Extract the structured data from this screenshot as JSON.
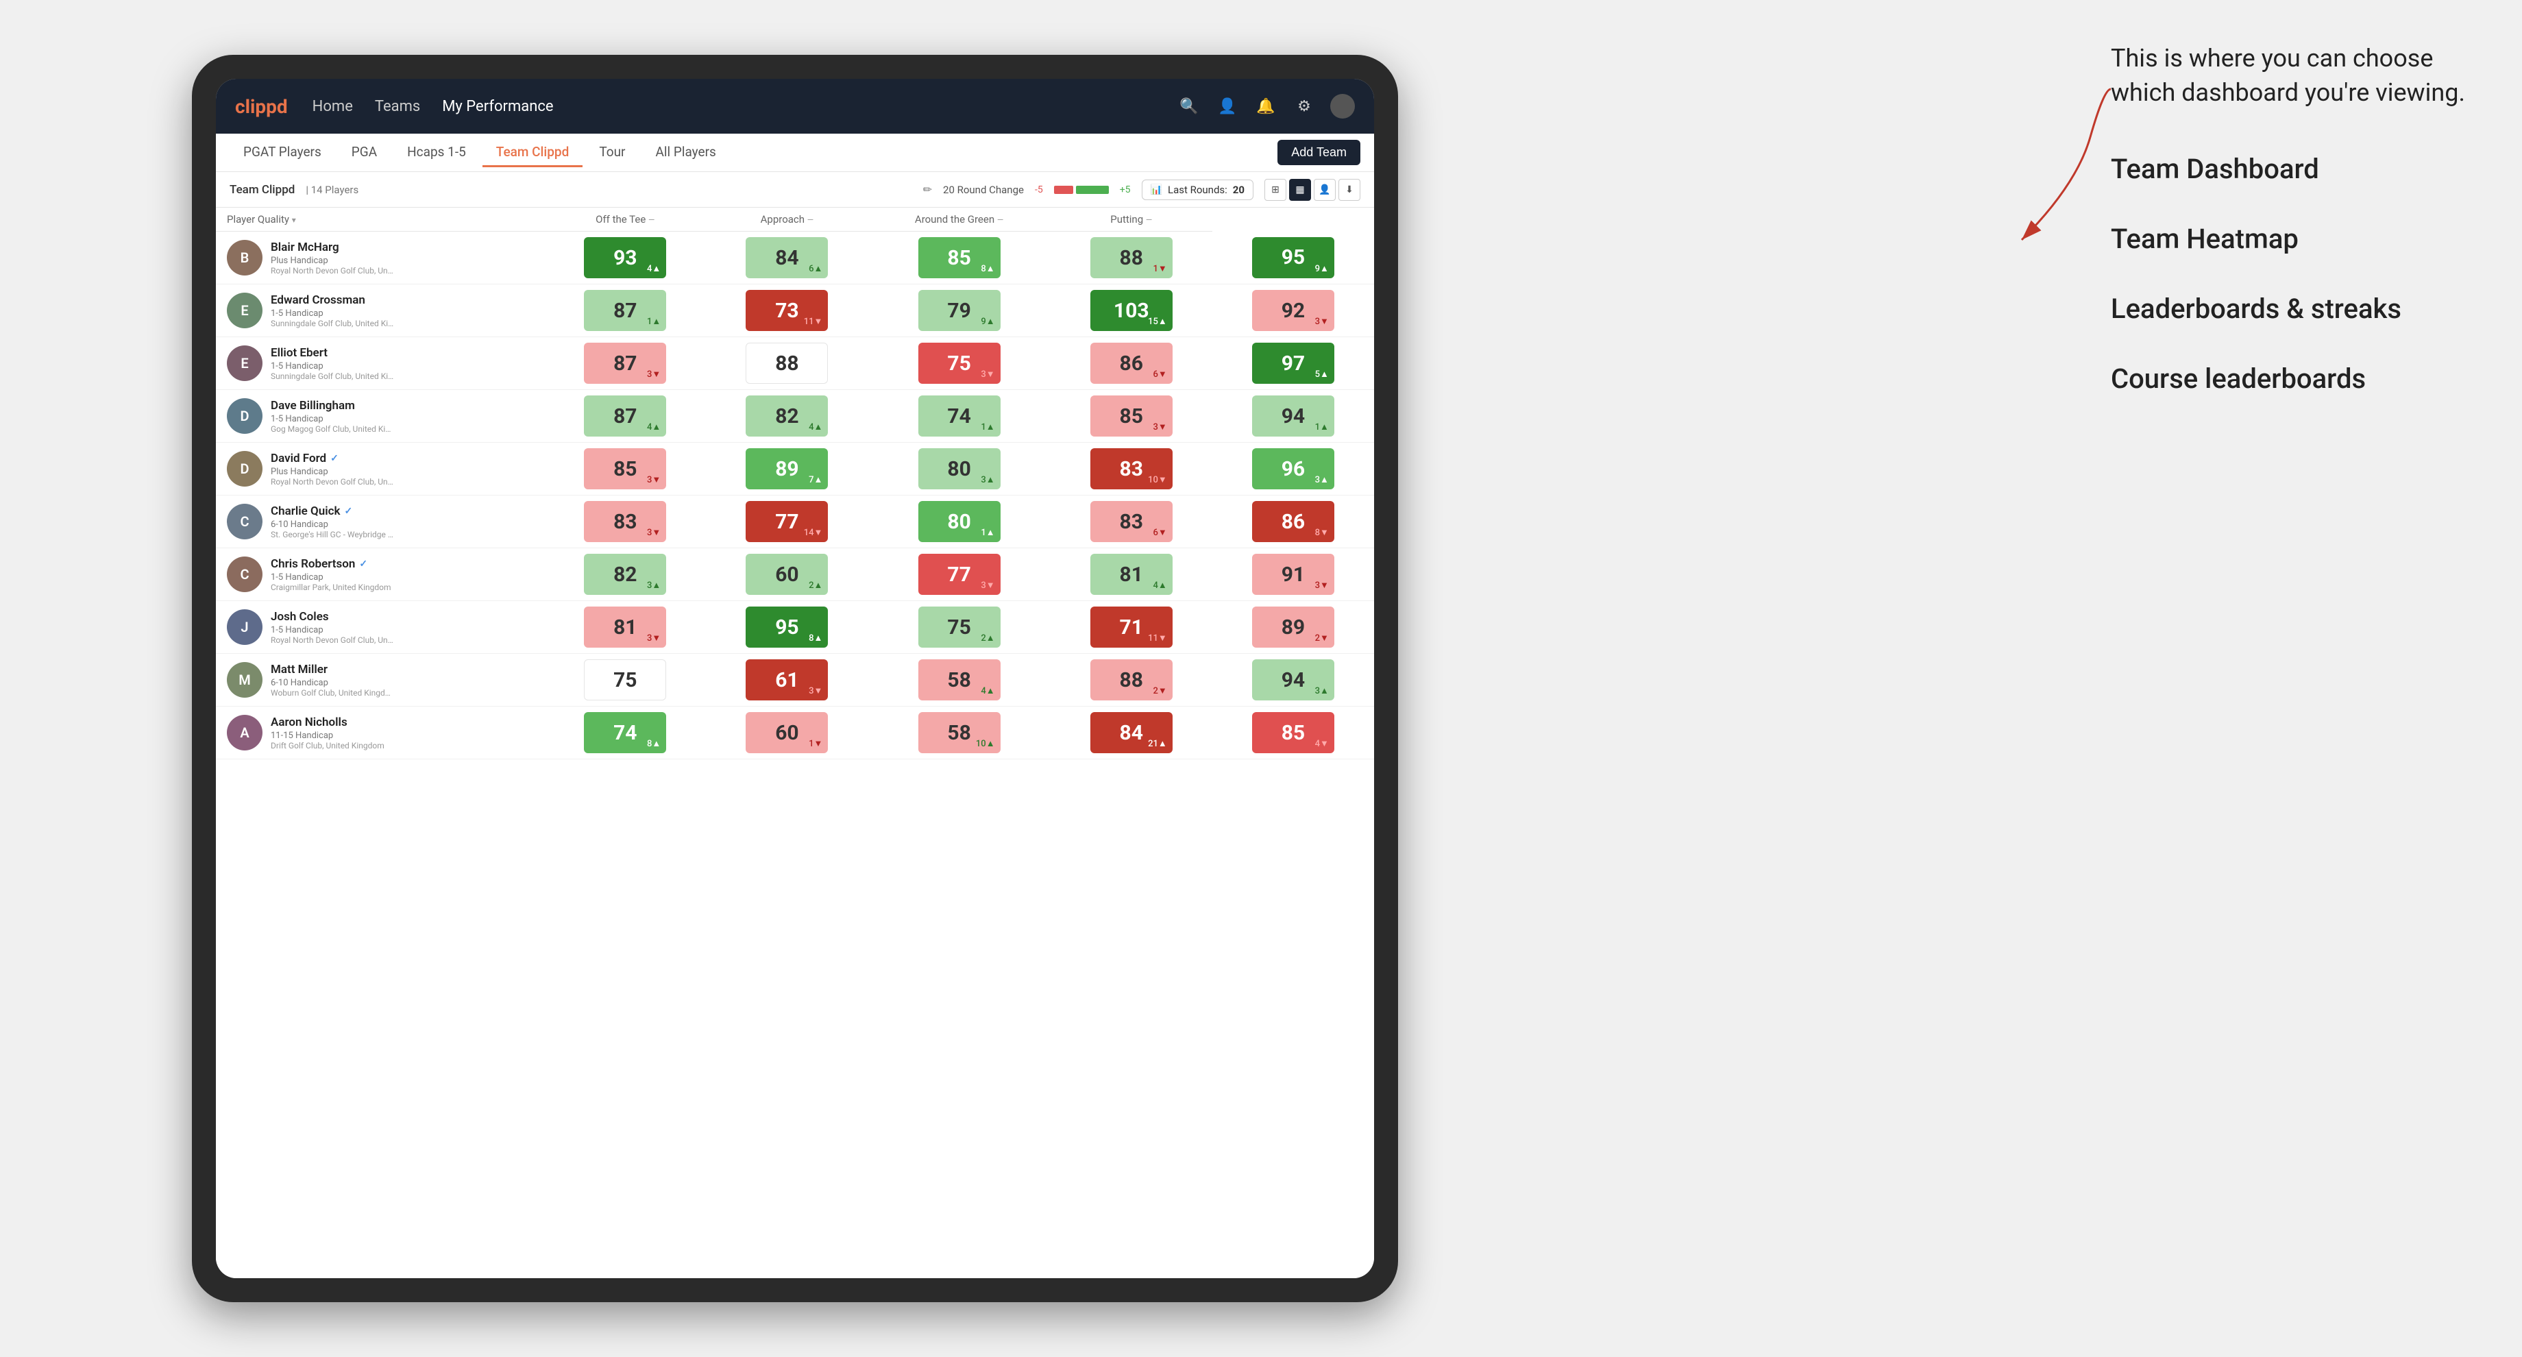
{
  "annotation": {
    "intro": "This is where you can choose which dashboard you're viewing.",
    "options": [
      "Team Dashboard",
      "Team Heatmap",
      "Leaderboards & streaks",
      "Course leaderboards"
    ]
  },
  "nav": {
    "logo": "clippd",
    "items": [
      "Home",
      "Teams",
      "My Performance"
    ],
    "active": "My Performance"
  },
  "tabs": {
    "items": [
      "PGAT Players",
      "PGA",
      "Hcaps 1-5",
      "Team Clippd",
      "Tour",
      "All Players"
    ],
    "active": "Team Clippd",
    "add_button": "Add Team"
  },
  "toolbar": {
    "team_name": "Team Clippd",
    "player_count": "| 14 Players",
    "round_change_label": "20 Round Change",
    "change_minus": "-5",
    "change_plus": "+5",
    "last_rounds_label": "Last Rounds:",
    "last_rounds_value": "20"
  },
  "table": {
    "headers": [
      {
        "label": "Player Quality",
        "sortable": true
      },
      {
        "label": "Off the Tee",
        "sortable": true
      },
      {
        "label": "Approach",
        "sortable": true
      },
      {
        "label": "Around the Green",
        "sortable": true
      },
      {
        "label": "Putting",
        "sortable": true
      }
    ],
    "players": [
      {
        "name": "Blair McHarg",
        "handicap": "Plus Handicap",
        "club": "Royal North Devon Golf Club, United Kingdom",
        "avatar_color": "#8B6F5E",
        "avatar_letter": "B",
        "scores": [
          {
            "value": 93,
            "change": 4,
            "dir": "up",
            "bg": "green-dark"
          },
          {
            "value": 84,
            "change": 6,
            "dir": "up",
            "bg": "green-light"
          },
          {
            "value": 85,
            "change": 8,
            "dir": "up",
            "bg": "green-mid"
          },
          {
            "value": 88,
            "change": 1,
            "dir": "down",
            "bg": "green-light"
          },
          {
            "value": 95,
            "change": 9,
            "dir": "up",
            "bg": "green-dark"
          }
        ]
      },
      {
        "name": "Edward Crossman",
        "handicap": "1-5 Handicap",
        "club": "Sunningdale Golf Club, United Kingdom",
        "avatar_color": "#6B8B6F",
        "avatar_letter": "E",
        "scores": [
          {
            "value": 87,
            "change": 1,
            "dir": "up",
            "bg": "green-light"
          },
          {
            "value": 73,
            "change": 11,
            "dir": "down",
            "bg": "red-dark"
          },
          {
            "value": 79,
            "change": 9,
            "dir": "up",
            "bg": "green-light"
          },
          {
            "value": 103,
            "change": 15,
            "dir": "up",
            "bg": "green-dark"
          },
          {
            "value": 92,
            "change": 3,
            "dir": "down",
            "bg": "red-light"
          }
        ]
      },
      {
        "name": "Elliot Ebert",
        "handicap": "1-5 Handicap",
        "club": "Sunningdale Golf Club, United Kingdom",
        "avatar_color": "#7B5E6B",
        "avatar_letter": "E",
        "scores": [
          {
            "value": 87,
            "change": 3,
            "dir": "down",
            "bg": "red-light"
          },
          {
            "value": 88,
            "change": null,
            "dir": null,
            "bg": "white"
          },
          {
            "value": 75,
            "change": 3,
            "dir": "down",
            "bg": "red-mid"
          },
          {
            "value": 86,
            "change": 6,
            "dir": "down",
            "bg": "red-light"
          },
          {
            "value": 97,
            "change": 5,
            "dir": "up",
            "bg": "green-dark"
          }
        ]
      },
      {
        "name": "Dave Billingham",
        "handicap": "1-5 Handicap",
        "club": "Gog Magog Golf Club, United Kingdom",
        "avatar_color": "#5E7B8B",
        "avatar_letter": "D",
        "scores": [
          {
            "value": 87,
            "change": 4,
            "dir": "up",
            "bg": "green-light"
          },
          {
            "value": 82,
            "change": 4,
            "dir": "up",
            "bg": "green-light"
          },
          {
            "value": 74,
            "change": 1,
            "dir": "up",
            "bg": "green-light"
          },
          {
            "value": 85,
            "change": 3,
            "dir": "down",
            "bg": "red-light"
          },
          {
            "value": 94,
            "change": 1,
            "dir": "up",
            "bg": "green-light"
          }
        ]
      },
      {
        "name": "David Ford",
        "handicap": "Plus Handicap",
        "club": "Royal North Devon Golf Club, United Kingdom",
        "avatar_color": "#8B7B5E",
        "avatar_letter": "D",
        "verified": true,
        "scores": [
          {
            "value": 85,
            "change": 3,
            "dir": "down",
            "bg": "red-light"
          },
          {
            "value": 89,
            "change": 7,
            "dir": "up",
            "bg": "green-mid"
          },
          {
            "value": 80,
            "change": 3,
            "dir": "up",
            "bg": "green-light"
          },
          {
            "value": 83,
            "change": 10,
            "dir": "down",
            "bg": "red-dark"
          },
          {
            "value": 96,
            "change": 3,
            "dir": "up",
            "bg": "green-mid"
          }
        ]
      },
      {
        "name": "Charlie Quick",
        "handicap": "6-10 Handicap",
        "club": "St. George's Hill GC - Weybridge - Surrey, Uni...",
        "avatar_color": "#6B7B8B",
        "avatar_letter": "C",
        "verified": true,
        "scores": [
          {
            "value": 83,
            "change": 3,
            "dir": "down",
            "bg": "red-light"
          },
          {
            "value": 77,
            "change": 14,
            "dir": "down",
            "bg": "red-dark"
          },
          {
            "value": 80,
            "change": 1,
            "dir": "up",
            "bg": "green-mid"
          },
          {
            "value": 83,
            "change": 6,
            "dir": "down",
            "bg": "red-light"
          },
          {
            "value": 86,
            "change": 8,
            "dir": "down",
            "bg": "red-dark"
          }
        ]
      },
      {
        "name": "Chris Robertson",
        "handicap": "1-5 Handicap",
        "club": "Craigmillar Park, United Kingdom",
        "avatar_color": "#8B6B5E",
        "avatar_letter": "C",
        "verified": true,
        "scores": [
          {
            "value": 82,
            "change": 3,
            "dir": "up",
            "bg": "green-light"
          },
          {
            "value": 60,
            "change": 2,
            "dir": "up",
            "bg": "green-light"
          },
          {
            "value": 77,
            "change": 3,
            "dir": "down",
            "bg": "red-mid"
          },
          {
            "value": 81,
            "change": 4,
            "dir": "up",
            "bg": "green-light"
          },
          {
            "value": 91,
            "change": 3,
            "dir": "down",
            "bg": "red-light"
          }
        ]
      },
      {
        "name": "Josh Coles",
        "handicap": "1-5 Handicap",
        "club": "Royal North Devon Golf Club, United Kingdom",
        "avatar_color": "#5E6B8B",
        "avatar_letter": "J",
        "scores": [
          {
            "value": 81,
            "change": 3,
            "dir": "down",
            "bg": "red-light"
          },
          {
            "value": 95,
            "change": 8,
            "dir": "up",
            "bg": "green-dark"
          },
          {
            "value": 75,
            "change": 2,
            "dir": "up",
            "bg": "green-light"
          },
          {
            "value": 71,
            "change": 11,
            "dir": "down",
            "bg": "red-dark"
          },
          {
            "value": 89,
            "change": 2,
            "dir": "down",
            "bg": "red-light"
          }
        ]
      },
      {
        "name": "Matt Miller",
        "handicap": "6-10 Handicap",
        "club": "Woburn Golf Club, United Kingdom",
        "avatar_color": "#7B8B6B",
        "avatar_letter": "M",
        "scores": [
          {
            "value": 75,
            "change": null,
            "dir": null,
            "bg": "white"
          },
          {
            "value": 61,
            "change": 3,
            "dir": "down",
            "bg": "red-dark"
          },
          {
            "value": 58,
            "change": 4,
            "dir": "up",
            "bg": "red-light"
          },
          {
            "value": 88,
            "change": 2,
            "dir": "down",
            "bg": "red-light"
          },
          {
            "value": 94,
            "change": 3,
            "dir": "up",
            "bg": "green-light"
          }
        ]
      },
      {
        "name": "Aaron Nicholls",
        "handicap": "11-15 Handicap",
        "club": "Drift Golf Club, United Kingdom",
        "avatar_color": "#8B5E7B",
        "avatar_letter": "A",
        "scores": [
          {
            "value": 74,
            "change": 8,
            "dir": "up",
            "bg": "green-mid"
          },
          {
            "value": 60,
            "change": 1,
            "dir": "down",
            "bg": "red-light"
          },
          {
            "value": 58,
            "change": 10,
            "dir": "up",
            "bg": "red-light"
          },
          {
            "value": 84,
            "change": 21,
            "dir": "up",
            "bg": "red-dark"
          },
          {
            "value": 85,
            "change": 4,
            "dir": "down",
            "bg": "red-mid"
          }
        ]
      }
    ]
  }
}
